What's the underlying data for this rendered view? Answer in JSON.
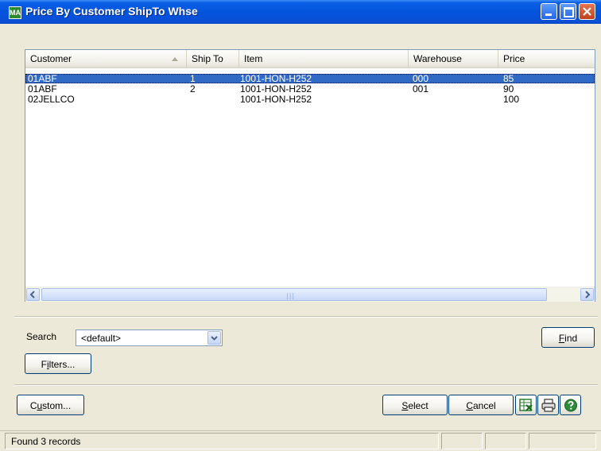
{
  "window": {
    "title": "Price By Customer ShipTo Whse",
    "app_icon": "MA"
  },
  "grid": {
    "columns": [
      "Customer",
      "Ship To",
      "Item",
      "Warehouse",
      "Price"
    ],
    "sorted_column": "Customer",
    "rows": [
      {
        "customer": "01ABF",
        "ship_to": "1",
        "item": "1001-HON-H252",
        "warehouse": "000",
        "price": "85",
        "selected": true
      },
      {
        "customer": "01ABF",
        "ship_to": "2",
        "item": "1001-HON-H252",
        "warehouse": "001",
        "price": "90",
        "selected": false
      },
      {
        "customer": "02JELLCO",
        "ship_to": "",
        "item": "1001-HON-H252",
        "warehouse": "",
        "price": "100",
        "selected": false
      }
    ]
  },
  "search": {
    "label": "Search",
    "value": "<default>"
  },
  "buttons": {
    "find": "Find",
    "filters": "Filters...",
    "custom": "Custom...",
    "select": "Select",
    "cancel": "Cancel"
  },
  "status": {
    "text": "Found 3 records"
  },
  "colors": {
    "title_bar": "#0453dc",
    "selection": "#316ac5",
    "window_bg": "#ece9d8"
  }
}
